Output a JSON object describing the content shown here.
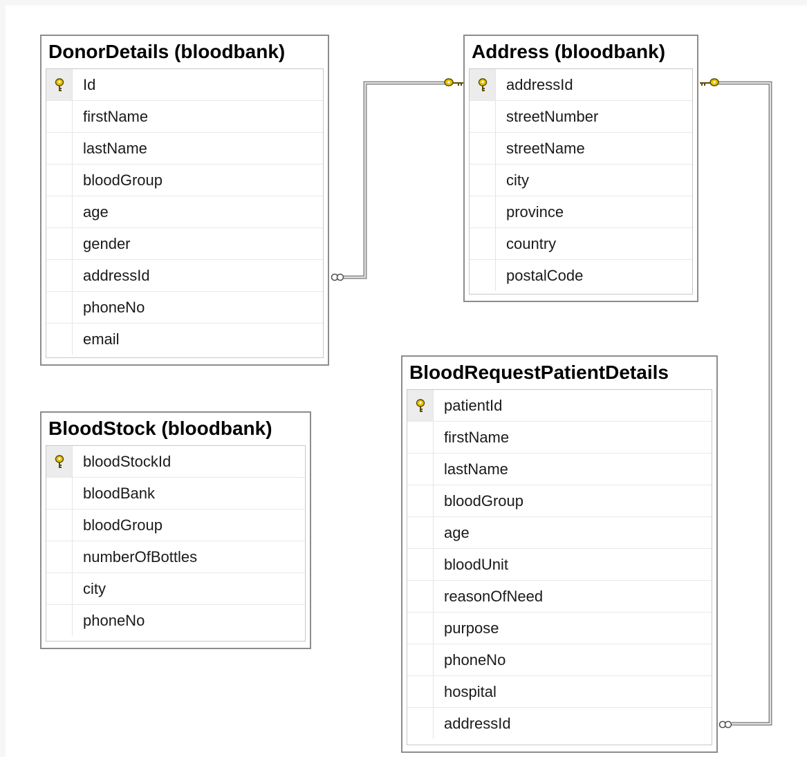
{
  "colors": {
    "key": "#d8b400",
    "connector": "#8a8a8a",
    "border": "#8c8c8c"
  },
  "tables": {
    "donor": {
      "title": "DonorDetails (bloodbank)",
      "columns": [
        {
          "name": "Id",
          "pk": true
        },
        {
          "name": "firstName",
          "pk": false
        },
        {
          "name": "lastName",
          "pk": false
        },
        {
          "name": "bloodGroup",
          "pk": false
        },
        {
          "name": "age",
          "pk": false
        },
        {
          "name": "gender",
          "pk": false
        },
        {
          "name": "addressId",
          "pk": false
        },
        {
          "name": "phoneNo",
          "pk": false
        },
        {
          "name": "email",
          "pk": false
        }
      ]
    },
    "address": {
      "title": "Address (bloodbank)",
      "columns": [
        {
          "name": "addressId",
          "pk": true
        },
        {
          "name": "streetNumber",
          "pk": false
        },
        {
          "name": "streetName",
          "pk": false
        },
        {
          "name": "city",
          "pk": false
        },
        {
          "name": "province",
          "pk": false
        },
        {
          "name": "country",
          "pk": false
        },
        {
          "name": "postalCode",
          "pk": false
        }
      ]
    },
    "stock": {
      "title": "BloodStock (bloodbank)",
      "columns": [
        {
          "name": "bloodStockId",
          "pk": true
        },
        {
          "name": "bloodBank",
          "pk": false
        },
        {
          "name": "bloodGroup",
          "pk": false
        },
        {
          "name": "numberOfBottles",
          "pk": false
        },
        {
          "name": "city",
          "pk": false
        },
        {
          "name": "phoneNo",
          "pk": false
        }
      ]
    },
    "patient": {
      "title": "BloodRequestPatientDetails",
      "columns": [
        {
          "name": "patientId",
          "pk": true
        },
        {
          "name": "firstName",
          "pk": false
        },
        {
          "name": "lastName",
          "pk": false
        },
        {
          "name": "bloodGroup",
          "pk": false
        },
        {
          "name": "age",
          "pk": false
        },
        {
          "name": "bloodUnit",
          "pk": false
        },
        {
          "name": "reasonOfNeed",
          "pk": false
        },
        {
          "name": "purpose",
          "pk": false
        },
        {
          "name": "phoneNo",
          "pk": false
        },
        {
          "name": "hospital",
          "pk": false
        },
        {
          "name": "addressId",
          "pk": false
        }
      ]
    }
  },
  "relationships": [
    {
      "from": "donor.addressId",
      "to": "address.addressId",
      "many_end": "infinity-icon",
      "one_end": "key-icon"
    },
    {
      "from": "patient.addressId",
      "to": "address.addressId",
      "many_end": "infinity-icon",
      "one_end": "key-icon"
    }
  ]
}
